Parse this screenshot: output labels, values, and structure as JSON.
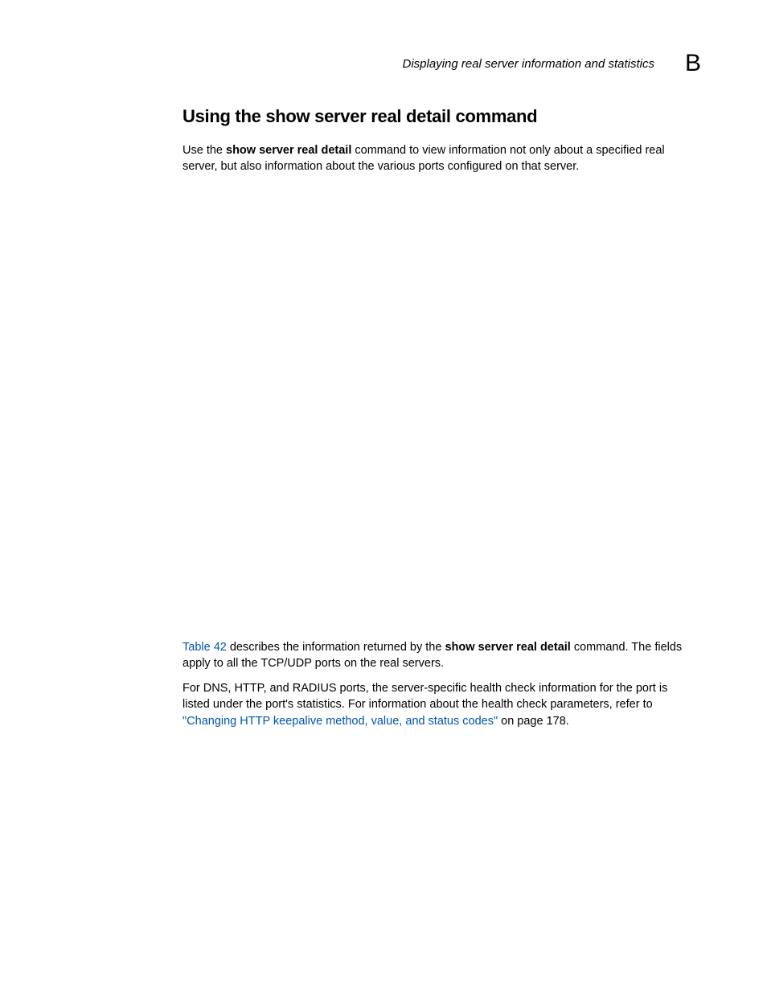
{
  "header": {
    "running_title": "Displaying real server information and statistics",
    "appendix_letter": "B"
  },
  "section": {
    "title": "Using the show server real detail command"
  },
  "paragraphs": {
    "p1_a": "Use the ",
    "p1_cmd": "show server real detail",
    "p1_b": " command to view information not only about a specified real server, but also information about the various ports configured on that server.",
    "p2_link": "Table 42",
    "p2_a": " describes the information returned by the ",
    "p2_cmd": "show server real detail",
    "p2_b": " command. The fields apply to all the TCP/UDP ports on the real servers.",
    "p3_a": "For DNS, HTTP, and RADIUS ports, the server-specific health check information for the port is listed under the port's statistics. For information about the health check parameters, refer to ",
    "p3_quote_open": "\"",
    "p3_link": "Changing HTTP keepalive method, value, and status codes",
    "p3_quote_close": "\"",
    "p3_b": " on page 178."
  }
}
